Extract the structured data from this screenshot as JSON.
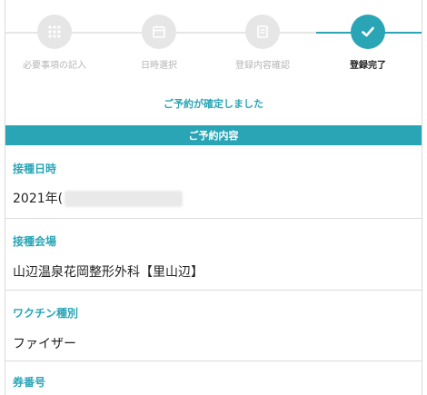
{
  "stepper": {
    "steps": [
      {
        "label": "必要事項の記入",
        "icon": "grid-icon",
        "state": "inactive"
      },
      {
        "label": "日時選択",
        "icon": "calendar-icon",
        "state": "inactive"
      },
      {
        "label": "登録内容確認",
        "icon": "document-icon",
        "state": "inactive"
      },
      {
        "label": "登録完了",
        "icon": "check-icon",
        "state": "active"
      }
    ]
  },
  "confirmation": {
    "message": "ご予約が確定しました",
    "section_title": "ご予約内容"
  },
  "fields": [
    {
      "label": "接種日時",
      "value": "2021年("
    },
    {
      "label": "接種会場",
      "value": "山辺温泉花岡整形外科【里山辺】"
    },
    {
      "label": "ワクチン種別",
      "value": "ファイザー"
    },
    {
      "label": "券番号",
      "value": ""
    }
  ],
  "colors": {
    "accent": "#2aa5b6",
    "inactive": "#e6e6e6",
    "inactive_text": "#b5b5b5"
  }
}
